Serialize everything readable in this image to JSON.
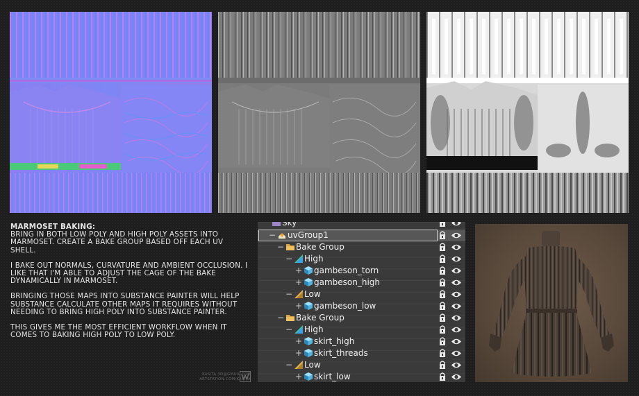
{
  "description": {
    "heading": "MARMOSET BAKING:",
    "paragraphs": [
      "BRING IN BOTH LOW POLY AND HIGH POLY ASSETS INTO MARMOSET. CREATE A BAKE GROUP BASED OFF EACH UV SHELL.",
      "I BAKE OUT NORMALS, CURVATURE AND AMBIENT OCCLUSION. I LIKE THAT I'M ABLE TO ADJUST THE CAGE OF THE BAKE DYNAMICALLY IN MARMOSET.",
      "BRINGING THOSE MAPS INTO SUBSTANCE PAINTER WILL HELP SUBSTANCE CALCULATE OTHER MAPS IT REQUIRES WITHOUT NEEDING TO BRING HIGH POLY INTO SUBSTANCE PAINTER.",
      "THIS GIVES ME THE MOST EFFICIENT WORKFLOW WHEN IT COMES TO BAKING HIGH POLY TO LOW POLY."
    ]
  },
  "credits": {
    "email": "KASITA.3D@GMAIL.COM",
    "site": "ARTSTATION.COM/KASITA"
  },
  "outliner": {
    "items": [
      {
        "label": "Sky",
        "icon": "sky-icon"
      },
      {
        "label": "uvGroup1",
        "icon": "group-icon",
        "selected": true
      },
      {
        "label": "Bake Group",
        "icon": "folder-icon"
      },
      {
        "label": "High",
        "icon": "high-icon"
      },
      {
        "label": "gambeson_torn",
        "icon": "mesh-icon"
      },
      {
        "label": "gambeson_high",
        "icon": "mesh-icon"
      },
      {
        "label": "Low",
        "icon": "low-icon"
      },
      {
        "label": "gambeson_low",
        "icon": "mesh-icon"
      },
      {
        "label": "Bake Group",
        "icon": "folder-icon"
      },
      {
        "label": "High",
        "icon": "high-icon"
      },
      {
        "label": "skirt_high",
        "icon": "mesh-icon"
      },
      {
        "label": "skirt_threads",
        "icon": "mesh-icon"
      },
      {
        "label": "Low",
        "icon": "low-icon"
      },
      {
        "label": "skirt_low",
        "icon": "mesh-icon"
      }
    ]
  },
  "textures": [
    {
      "name": "Normal map",
      "base_color": "#8080ff"
    },
    {
      "name": "Curvature map",
      "base_color": "#808080"
    },
    {
      "name": "Ambient occlusion map",
      "base_color": "#e8e8e8"
    }
  ],
  "colors": {
    "background": "#1e1e1e",
    "outliner_bg": "#3a3a3a",
    "folder": "#d9a548",
    "mesh": "#56b6e0"
  }
}
